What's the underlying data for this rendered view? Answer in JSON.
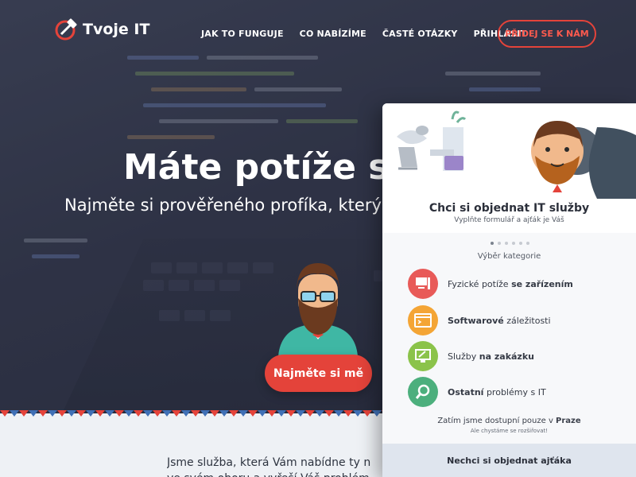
{
  "brand": {
    "name": "Tvoje IT",
    "accent": "#e4433a"
  },
  "nav": {
    "items": [
      "JAK TO FUNGUJE",
      "CO NABÍZÍME",
      "ČASTÉ OTÁZKY",
      "PŘIHLÁSIT"
    ],
    "cta": "PŘIDEJ SE K NÁM"
  },
  "hero": {
    "title": "Máte potíže s E",
    "subtitle": "Najměte si prověřeného profíka, který vy",
    "cta": "Najměte si mě"
  },
  "about": {
    "line1": "Jsme služba, která Vám nabídne ty n",
    "line2": "ve svém oboru a vyřeší Váš problém"
  },
  "panel": {
    "title": "Chci si objednat IT služby",
    "subtitle": "Vyplňte formulář a ajťák je Váš",
    "category_heading": "Výběr kategorie",
    "categories": [
      {
        "prefix": "Fyzické potíže ",
        "bold": "se zařízením",
        "suffix": "",
        "color": "#e85a58",
        "icon": "computer-icon"
      },
      {
        "prefix": "",
        "bold": "Softwarové",
        "suffix": " záležitosti",
        "color": "#f4a535",
        "icon": "terminal-icon"
      },
      {
        "prefix": "Služby ",
        "bold": "na zakázku",
        "suffix": "",
        "color": "#8bc34a",
        "icon": "wrench-monitor-icon"
      },
      {
        "prefix": "",
        "bold": "Ostatní",
        "suffix": " problémy s IT",
        "color": "#4caf7d",
        "icon": "magnifier-icon"
      }
    ],
    "availability_prefix": "Zatím jsme dostupní pouze v ",
    "availability_city": "Praze",
    "availability_note": "Ale chystáme se rozšiřovat!",
    "footer": "Nechci si objednat ajťáka"
  }
}
